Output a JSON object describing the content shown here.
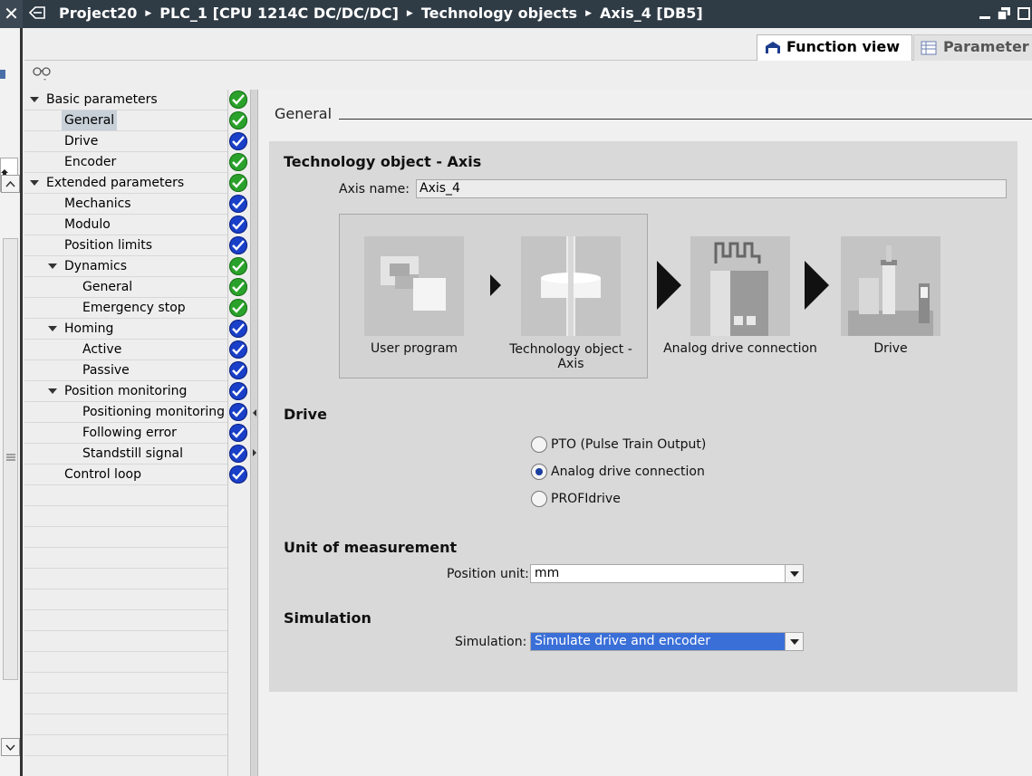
{
  "titlebar": {
    "breadcrumb": [
      "Project20",
      "PLC_1 [CPU 1214C DC/DC/DC]",
      "Technology objects",
      "Axis_4 [DB5]"
    ]
  },
  "tabs": {
    "function_view": "Function view",
    "parameter_view": "Parameter view"
  },
  "nav": {
    "items": [
      {
        "label": "Basic parameters",
        "status": "green",
        "expand": true
      },
      {
        "label": "General",
        "status": "green",
        "selected": true
      },
      {
        "label": "Drive",
        "status": "blue"
      },
      {
        "label": "Encoder",
        "status": "green"
      },
      {
        "label": "Extended parameters",
        "status": "green",
        "expand": true
      },
      {
        "label": "Mechanics",
        "status": "blue"
      },
      {
        "label": "Modulo",
        "status": "blue"
      },
      {
        "label": "Position limits",
        "status": "blue"
      },
      {
        "label": "Dynamics",
        "status": "green",
        "expand": true
      },
      {
        "label": "General",
        "status": "green"
      },
      {
        "label": "Emergency stop",
        "status": "green"
      },
      {
        "label": "Homing",
        "status": "blue",
        "expand": true
      },
      {
        "label": "Active",
        "status": "blue"
      },
      {
        "label": "Passive",
        "status": "blue"
      },
      {
        "label": "Position monitoring",
        "status": "blue",
        "expand": true
      },
      {
        "label": "Positioning monitoring",
        "status": "blue"
      },
      {
        "label": "Following error",
        "status": "blue"
      },
      {
        "label": "Standstill signal",
        "status": "blue"
      },
      {
        "label": "Control loop",
        "status": "blue"
      }
    ]
  },
  "content": {
    "section_title": "General",
    "tech_object": {
      "heading": "Technology object - Axis",
      "axis_name_label": "Axis name:",
      "axis_name_value": "Axis_4"
    },
    "diagram": {
      "blocks": [
        "User program",
        "Technology object - Axis",
        "Analog drive connection",
        "Drive"
      ]
    },
    "drive": {
      "heading": "Drive",
      "options": [
        "PTO (Pulse Train Output)",
        "Analog drive connection",
        "PROFIdrive"
      ],
      "selected": "Analog drive connection"
    },
    "unit": {
      "heading": "Unit of measurement",
      "position_unit_label": "Position unit:",
      "position_unit_value": "mm"
    },
    "simulation": {
      "heading": "Simulation",
      "label": "Simulation:",
      "value": "Simulate drive and encoder"
    }
  },
  "colors": {
    "ok_green": "#2aa12a",
    "info_blue": "#1a3fc8",
    "selection": "#3a6fd8",
    "titlebar": "#2f3b45"
  }
}
